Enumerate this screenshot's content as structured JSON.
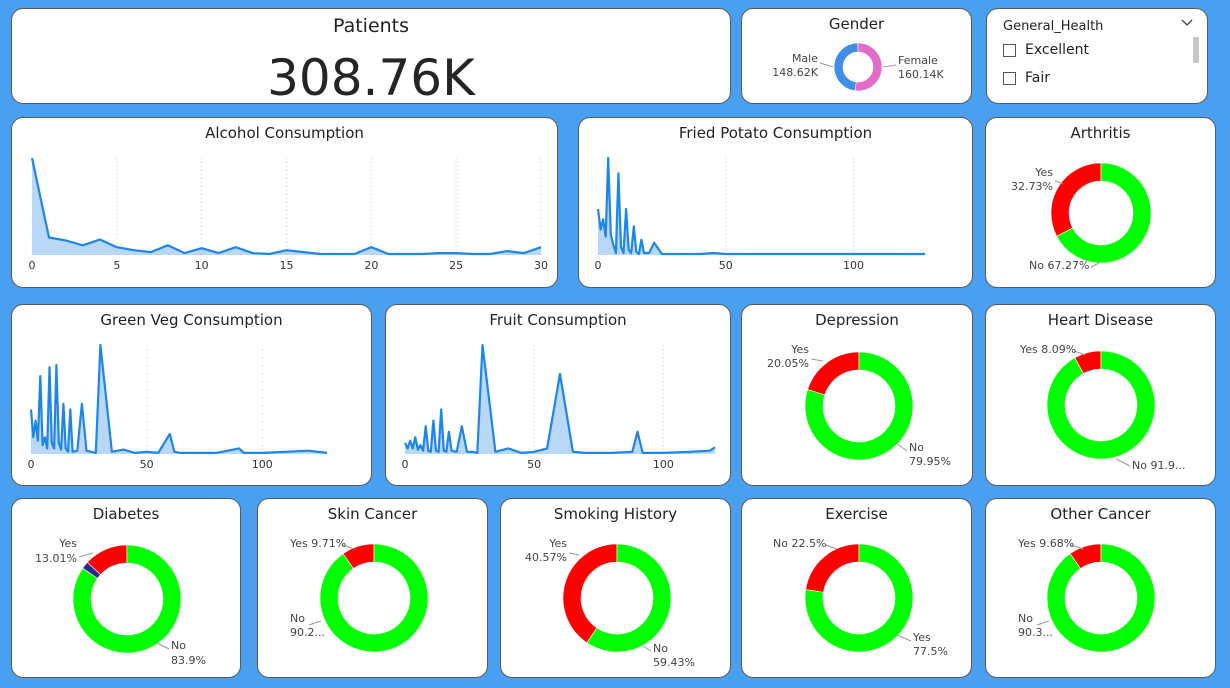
{
  "kpi": {
    "title": "Patients",
    "value": "308.76K"
  },
  "slicer": {
    "title": "General_Health",
    "items": [
      "Excellent",
      "Fair"
    ]
  },
  "chart_data": [
    {
      "id": "gender",
      "type": "pie",
      "title": "Gender",
      "slices": [
        {
          "label": "Male",
          "value": 148.62,
          "display": "148.62K",
          "color": "#3f8fe8"
        },
        {
          "label": "Female",
          "value": 160.14,
          "display": "160.14K",
          "color": "#e46bc9"
        }
      ]
    },
    {
      "id": "alcohol",
      "type": "area",
      "title": "Alcohol Consumption",
      "xlim": [
        0,
        30
      ],
      "xticks": [
        0,
        5,
        10,
        15,
        20,
        25,
        30
      ],
      "x": [
        0,
        1,
        2,
        3,
        4,
        5,
        6,
        7,
        8,
        9,
        10,
        11,
        12,
        13,
        14,
        15,
        16,
        17,
        18,
        19,
        20,
        21,
        22,
        23,
        24,
        25,
        26,
        27,
        28,
        29,
        30
      ],
      "y": [
        100,
        18,
        15,
        10,
        16,
        8,
        5,
        3,
        10,
        2,
        7,
        2,
        8,
        2,
        1,
        5,
        3,
        1,
        1,
        1,
        8,
        1,
        1,
        1,
        2,
        2,
        1,
        1,
        4,
        2,
        8
      ]
    },
    {
      "id": "fried",
      "type": "area",
      "title": "Fried Potato Consumption",
      "xlim": [
        0,
        128
      ],
      "xticks": [
        0,
        50,
        100
      ],
      "x": [
        0,
        1,
        2,
        3,
        4,
        5,
        6,
        7,
        8,
        9,
        10,
        11,
        12,
        13,
        14,
        15,
        16,
        17,
        18,
        20,
        22,
        25,
        28,
        30,
        35,
        40,
        45,
        50,
        55,
        60,
        70,
        80,
        90,
        100,
        110,
        120,
        128
      ],
      "y": [
        45,
        25,
        35,
        18,
        95,
        20,
        10,
        2,
        80,
        8,
        2,
        45,
        5,
        2,
        28,
        3,
        1,
        15,
        2,
        2,
        12,
        1,
        1,
        1,
        1,
        1,
        2,
        1,
        1,
        1,
        1,
        1,
        1,
        1,
        1,
        1,
        1
      ]
    },
    {
      "id": "arthritis",
      "type": "pie",
      "title": "Arthritis",
      "slices": [
        {
          "label": "Yes",
          "value": 32.73,
          "display": "32.73%",
          "color": "#ff0000"
        },
        {
          "label": "No",
          "value": 67.27,
          "display": "67.27%",
          "color": "#00ff00"
        }
      ]
    },
    {
      "id": "greenveg",
      "type": "area",
      "title": "Green Veg Consumption",
      "xlim": [
        0,
        128
      ],
      "xticks": [
        0,
        50,
        100
      ],
      "x": [
        0,
        1,
        2,
        3,
        4,
        5,
        6,
        7,
        8,
        9,
        10,
        11,
        12,
        13,
        14,
        15,
        16,
        17,
        18,
        20,
        22,
        24,
        26,
        28,
        30,
        35,
        40,
        45,
        50,
        55,
        60,
        62,
        65,
        70,
        80,
        90,
        92,
        100,
        110,
        120,
        128
      ],
      "y": [
        40,
        15,
        30,
        12,
        70,
        8,
        15,
        5,
        78,
        10,
        5,
        80,
        10,
        4,
        45,
        5,
        2,
        40,
        2,
        3,
        45,
        3,
        2,
        1,
        98,
        2,
        4,
        1,
        2,
        1,
        18,
        2,
        1,
        1,
        1,
        5,
        1,
        1,
        2,
        3,
        1
      ]
    },
    {
      "id": "fruit",
      "type": "area",
      "title": "Fruit Consumption",
      "xlim": [
        0,
        120
      ],
      "xticks": [
        0,
        50,
        100
      ],
      "x": [
        0,
        1,
        2,
        3,
        4,
        5,
        6,
        7,
        8,
        9,
        10,
        11,
        12,
        13,
        14,
        15,
        16,
        17,
        18,
        20,
        22,
        24,
        26,
        28,
        30,
        35,
        40,
        45,
        50,
        55,
        60,
        65,
        70,
        80,
        88,
        90,
        92,
        100,
        110,
        118,
        120
      ],
      "y": [
        10,
        5,
        12,
        5,
        15,
        4,
        8,
        3,
        25,
        3,
        2,
        30,
        3,
        2,
        40,
        3,
        2,
        20,
        3,
        2,
        25,
        2,
        2,
        1,
        98,
        2,
        5,
        1,
        2,
        5,
        72,
        2,
        1,
        1,
        2,
        20,
        1,
        1,
        2,
        3,
        6
      ]
    },
    {
      "id": "depression",
      "type": "pie",
      "title": "Depression",
      "slices": [
        {
          "label": "Yes",
          "value": 20.05,
          "display": "20.05%",
          "color": "#ff0000"
        },
        {
          "label": "No",
          "value": 79.95,
          "display": "79.95%",
          "color": "#00ff00"
        }
      ]
    },
    {
      "id": "heart",
      "type": "pie",
      "title": "Heart Disease",
      "slices": [
        {
          "label": "Yes",
          "value": 8.09,
          "display": "8.09%",
          "color": "#ff0000"
        },
        {
          "label": "No",
          "value": 91.91,
          "display": "91.9...",
          "color": "#00ff00"
        }
      ]
    },
    {
      "id": "diabetes",
      "type": "pie",
      "title": "Diabetes",
      "slices": [
        {
          "label": "",
          "value": 2.2,
          "display": "",
          "color": "#2b2b8f"
        },
        {
          "label": "Yes",
          "value": 13.01,
          "display": "13.01%",
          "color": "#ff0000"
        },
        {
          "label": "No",
          "value": 83.9,
          "display": "83.9%",
          "color": "#00ff00"
        }
      ]
    },
    {
      "id": "skin",
      "type": "pie",
      "title": "Skin Cancer",
      "slices": [
        {
          "label": "Yes",
          "value": 9.71,
          "display": "9.71%",
          "color": "#ff0000"
        },
        {
          "label": "No",
          "value": 90.29,
          "display": "90.2...",
          "color": "#00ff00"
        }
      ]
    },
    {
      "id": "smoking",
      "type": "pie",
      "title": "Smoking History",
      "slices": [
        {
          "label": "Yes",
          "value": 40.57,
          "display": "40.57%",
          "color": "#ff0000"
        },
        {
          "label": "No",
          "value": 59.43,
          "display": "59.43%",
          "color": "#00ff00"
        }
      ]
    },
    {
      "id": "exercise",
      "type": "pie",
      "title": "Exercise",
      "slices": [
        {
          "label": "No",
          "value": 22.5,
          "display": "22.5%",
          "color": "#ff0000"
        },
        {
          "label": "Yes",
          "value": 77.5,
          "display": "77.5%",
          "color": "#00ff00"
        }
      ]
    },
    {
      "id": "other",
      "type": "pie",
      "title": "Other Cancer",
      "slices": [
        {
          "label": "Yes",
          "value": 9.68,
          "display": "9.68%",
          "color": "#ff0000"
        },
        {
          "label": "No",
          "value": 90.32,
          "display": "90.3...",
          "color": "#00ff00"
        }
      ]
    }
  ]
}
